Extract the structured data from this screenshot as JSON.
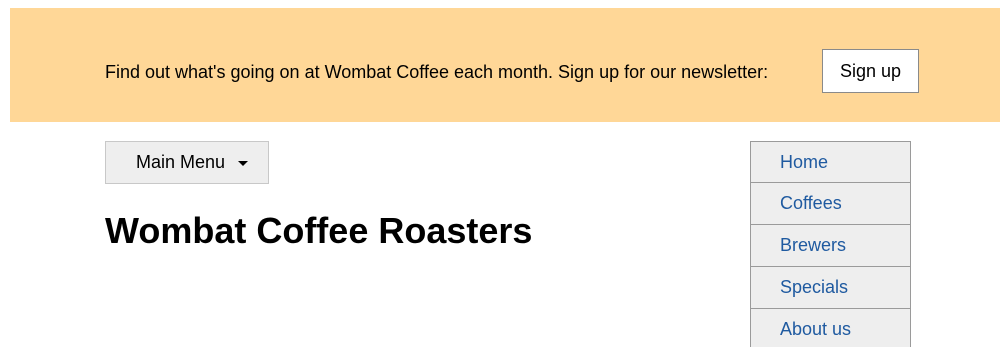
{
  "banner": {
    "text": "Find out what's going on at Wombat Coffee each month. Sign up for our newsletter:",
    "signup_label": "Sign up",
    "background_color": "#ffd797"
  },
  "menu": {
    "label": "Main Menu",
    "icon": "caret-down-icon"
  },
  "page": {
    "title": "Wombat Coffee Roasters"
  },
  "nav": {
    "link_color": "#1f5aa0",
    "items": [
      {
        "label": "Home"
      },
      {
        "label": "Coffees"
      },
      {
        "label": "Brewers"
      },
      {
        "label": "Specials"
      },
      {
        "label": "About us"
      }
    ]
  }
}
